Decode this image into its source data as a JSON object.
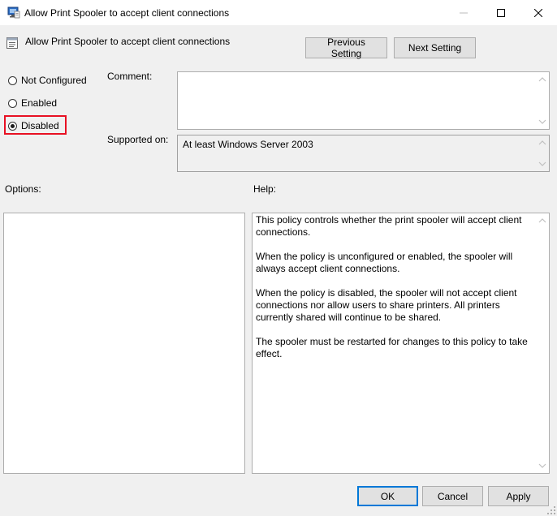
{
  "window": {
    "title": "Allow Print Spooler to accept client connections"
  },
  "header": {
    "policy_title": "Allow Print Spooler to accept client connections",
    "previous_label": "Previous Setting",
    "next_label": "Next Setting"
  },
  "state": {
    "options": [
      {
        "label": "Not Configured",
        "checked": false
      },
      {
        "label": "Enabled",
        "checked": false
      },
      {
        "label": "Disabled",
        "checked": true
      }
    ],
    "highlight_color": "#e81123"
  },
  "comment": {
    "label": "Comment:",
    "value": ""
  },
  "supported": {
    "label": "Supported on:",
    "value": "At least Windows Server 2003"
  },
  "panels": {
    "options_label": "Options:",
    "help_label": "Help:",
    "help_text": "This policy controls whether the print spooler will accept client connections.\n\nWhen the policy is unconfigured or enabled, the spooler will always accept client connections.\n\nWhen the policy is disabled, the spooler will not accept client connections nor allow users to share printers.  All printers currently shared will continue to be shared.\n\nThe spooler must be restarted for changes to this policy to take effect."
  },
  "footer": {
    "ok_label": "OK",
    "cancel_label": "Cancel",
    "apply_label": "Apply"
  },
  "icons": {
    "app": "policy-app-icon",
    "setting": "policy-setting-icon"
  }
}
